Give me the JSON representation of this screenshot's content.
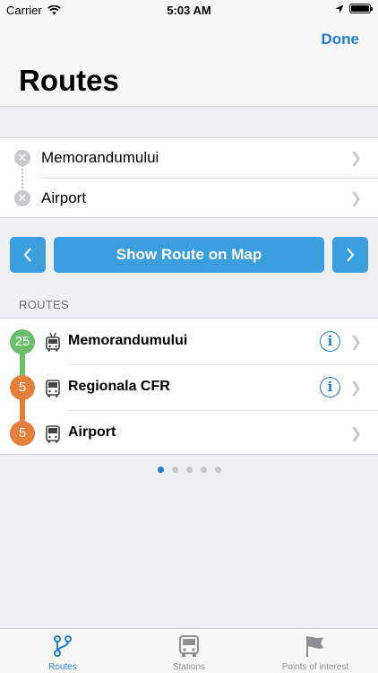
{
  "status_bar": {
    "carrier": "Carrier",
    "time": "5:03 AM"
  },
  "nav": {
    "done_label": "Done",
    "title": "Routes"
  },
  "stops": [
    {
      "name": "Memorandumului"
    },
    {
      "name": "Airport"
    }
  ],
  "actions": {
    "show_route_label": "Show Route on Map",
    "prev_icon": "chevron-left-icon",
    "next_icon": "chevron-right-icon"
  },
  "routes_section": {
    "header": "ROUTES",
    "items": [
      {
        "line": "25",
        "color": "#6bbf6b",
        "vehicle": "trolleybus-icon",
        "name": "Memorandumului",
        "info": true
      },
      {
        "line": "5",
        "color": "#e57f3c",
        "vehicle": "bus-icon",
        "name": "Regionala CFR",
        "info": true
      },
      {
        "line": "5",
        "color": "#e57f3c",
        "vehicle": "bus-icon",
        "name": "Airport",
        "info": false
      }
    ]
  },
  "pagination": {
    "total": 5,
    "current": 1
  },
  "tabs": [
    {
      "label": "Routes",
      "icon": "route-icon",
      "active": true
    },
    {
      "label": "Stations",
      "icon": "bus-icon",
      "active": false
    },
    {
      "label": "Points of interest",
      "icon": "flag-icon",
      "active": false
    }
  ],
  "colors": {
    "accent": "#1e7ed4",
    "button": "#3a9edf",
    "line_green": "#6bbf6b",
    "line_orange": "#e57f3c"
  }
}
